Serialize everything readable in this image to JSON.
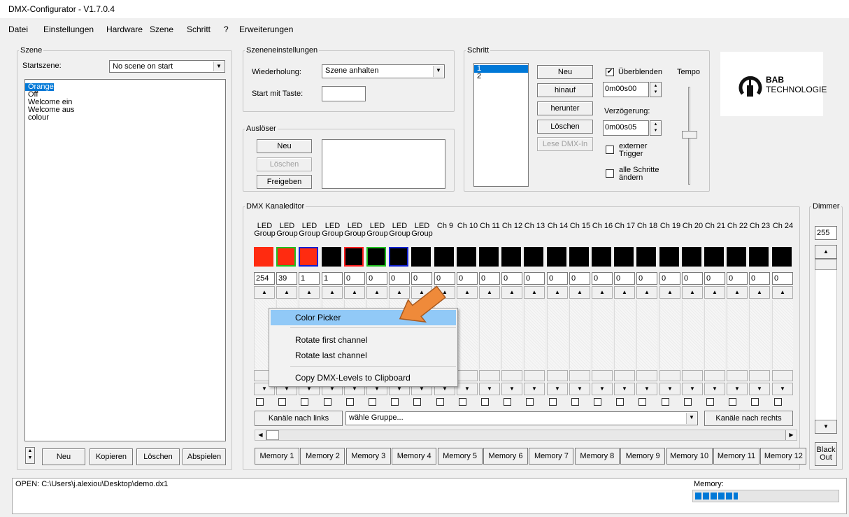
{
  "window": {
    "title": "DMX-Configurator - V1.7.0.4"
  },
  "menu": [
    "Datei",
    "Einstellungen",
    "Hardware",
    "Szene",
    "Schritt",
    "?",
    "Erweiterungen"
  ],
  "scene": {
    "legend": "Szene",
    "start_label": "Startszene:",
    "start_value": "No scene on start",
    "items": [
      "Orange",
      "Off",
      "Welcome ein",
      "Welcome aus",
      "colour"
    ],
    "buttons": {
      "new": "Neu",
      "copy": "Kopieren",
      "delete": "Löschen",
      "play": "Abspielen"
    }
  },
  "scene_settings": {
    "legend": "Szeneneinstellungen",
    "repeat_label": "Wiederholung:",
    "repeat_value": "Szene anhalten",
    "start_key_label": "Start mit Taste:",
    "start_key_value": ""
  },
  "trigger": {
    "legend": "Auslöser",
    "new": "Neu",
    "delete": "Löschen",
    "release": "Freigeben"
  },
  "step": {
    "legend": "Schritt",
    "items": [
      "1",
      "2"
    ],
    "buttons": {
      "new": "Neu",
      "up": "hinauf",
      "down": "herunter",
      "delete": "Löschen",
      "read_dmx": "Lese DMX-In"
    },
    "fade_label": "Überblenden",
    "fade_checked": true,
    "fade_value": "0m00s00",
    "delay_label": "Verzögerung:",
    "delay_value": "0m00s05",
    "external_label": "externer Trigger",
    "all_steps_label": "alle Schritte ändern",
    "tempo_label": "Tempo"
  },
  "logo": {
    "line1": "BAB",
    "line2": "TECHNOLOGIE"
  },
  "dmx": {
    "legend": "DMX Kanaleditor",
    "led_label_top": "LED",
    "led_label_bottom": "Group",
    "channel_labels": [
      "Ch 9",
      "Ch 10",
      "Ch 11",
      "Ch 12",
      "Ch 13",
      "Ch 14",
      "Ch 15",
      "Ch 16",
      "Ch 17",
      "Ch 18",
      "Ch 19",
      "Ch 20",
      "Ch 21",
      "Ch 22",
      "Ch 23",
      "Ch 24"
    ],
    "swatches": [
      {
        "fill": "#ff2b10",
        "border": "#ff2b10"
      },
      {
        "fill": "#ff2b10",
        "border": "#20c020"
      },
      {
        "fill": "#ff2b10",
        "border": "#1020d0"
      },
      {
        "fill": "#000000",
        "border": "#000000"
      },
      {
        "fill": "#000000",
        "border": "#ff2020"
      },
      {
        "fill": "#000000",
        "border": "#20c020"
      },
      {
        "fill": "#000000",
        "border": "#1020d0"
      }
    ],
    "values": [
      "254",
      "39",
      "1",
      "1",
      "0",
      "0",
      "0",
      "0",
      "0",
      "0",
      "0",
      "0",
      "0",
      "0",
      "0",
      "0",
      "0",
      "0",
      "0",
      "0",
      "0",
      "0",
      "0",
      "0"
    ],
    "left_button": "Kanäle nach links",
    "group_select": "wähle Gruppe...",
    "right_button": "Kanäle nach rechts",
    "memories": [
      "Memory 1",
      "Memory 2",
      "Memory 3",
      "Memory 4",
      "Memory 5",
      "Memory 6",
      "Memory 7",
      "Memory 8",
      "Memory 9",
      "Memory 10",
      "Memory 11",
      "Memory 12"
    ]
  },
  "dimmer": {
    "legend": "Dimmer",
    "value": "255",
    "blackout": "Black Out"
  },
  "context_menu": {
    "items": [
      "Color Picker",
      "Rotate first channel",
      "Rotate last channel",
      "Copy DMX-Levels to Clipboard"
    ]
  },
  "status": {
    "log": "OPEN: C:\\Users\\j.alexiou\\Desktop\\demo.dx1",
    "memory_label": "Memory:",
    "memory_fill": 0.3
  },
  "colors": {
    "highlight": "#0078d7",
    "menu_hover": "#91c9f7",
    "arrow": "#ef8a3a"
  }
}
